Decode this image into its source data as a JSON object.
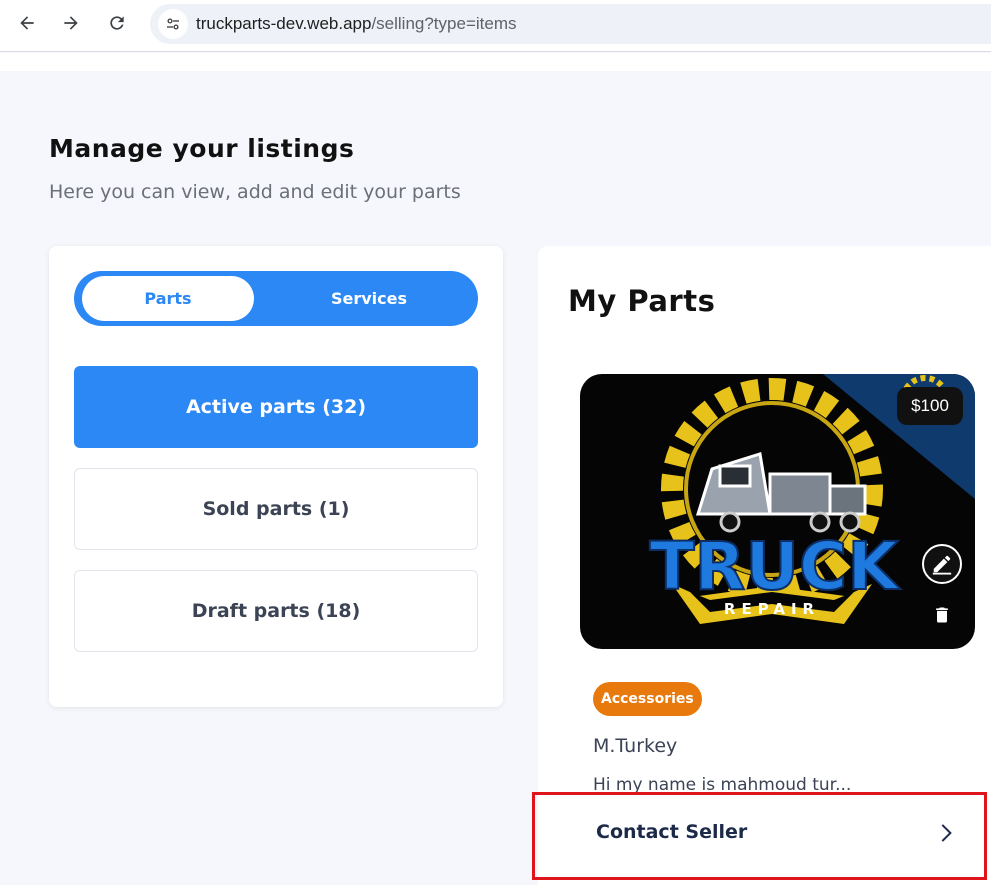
{
  "browser": {
    "url_domain": "truckparts-dev.web.app",
    "url_path": "/selling?type=items"
  },
  "header": {
    "title": "Manage your listings",
    "subtitle": "Here you can view, add and edit your parts"
  },
  "sidebar": {
    "toggle": {
      "parts_label": "Parts",
      "services_label": "Services",
      "selected": "Parts"
    },
    "categories": [
      {
        "label": "Active parts (32)",
        "active": true
      },
      {
        "label": "Sold parts (1)",
        "active": false
      },
      {
        "label": "Draft parts (18)",
        "active": false
      }
    ]
  },
  "main": {
    "title": "My Parts",
    "card": {
      "price": "$100",
      "logo_text": {
        "word": "TRUCK",
        "sub": "REPAIR"
      },
      "category_badge": "Accessories",
      "seller_name": "M.Turkey",
      "description": "Hi my name is mahmoud tur...",
      "contact_label": "Contact Seller"
    }
  },
  "colors": {
    "primary": "#2b88f5",
    "badge": "#e8790c",
    "highlight_box": "#e0151b"
  }
}
